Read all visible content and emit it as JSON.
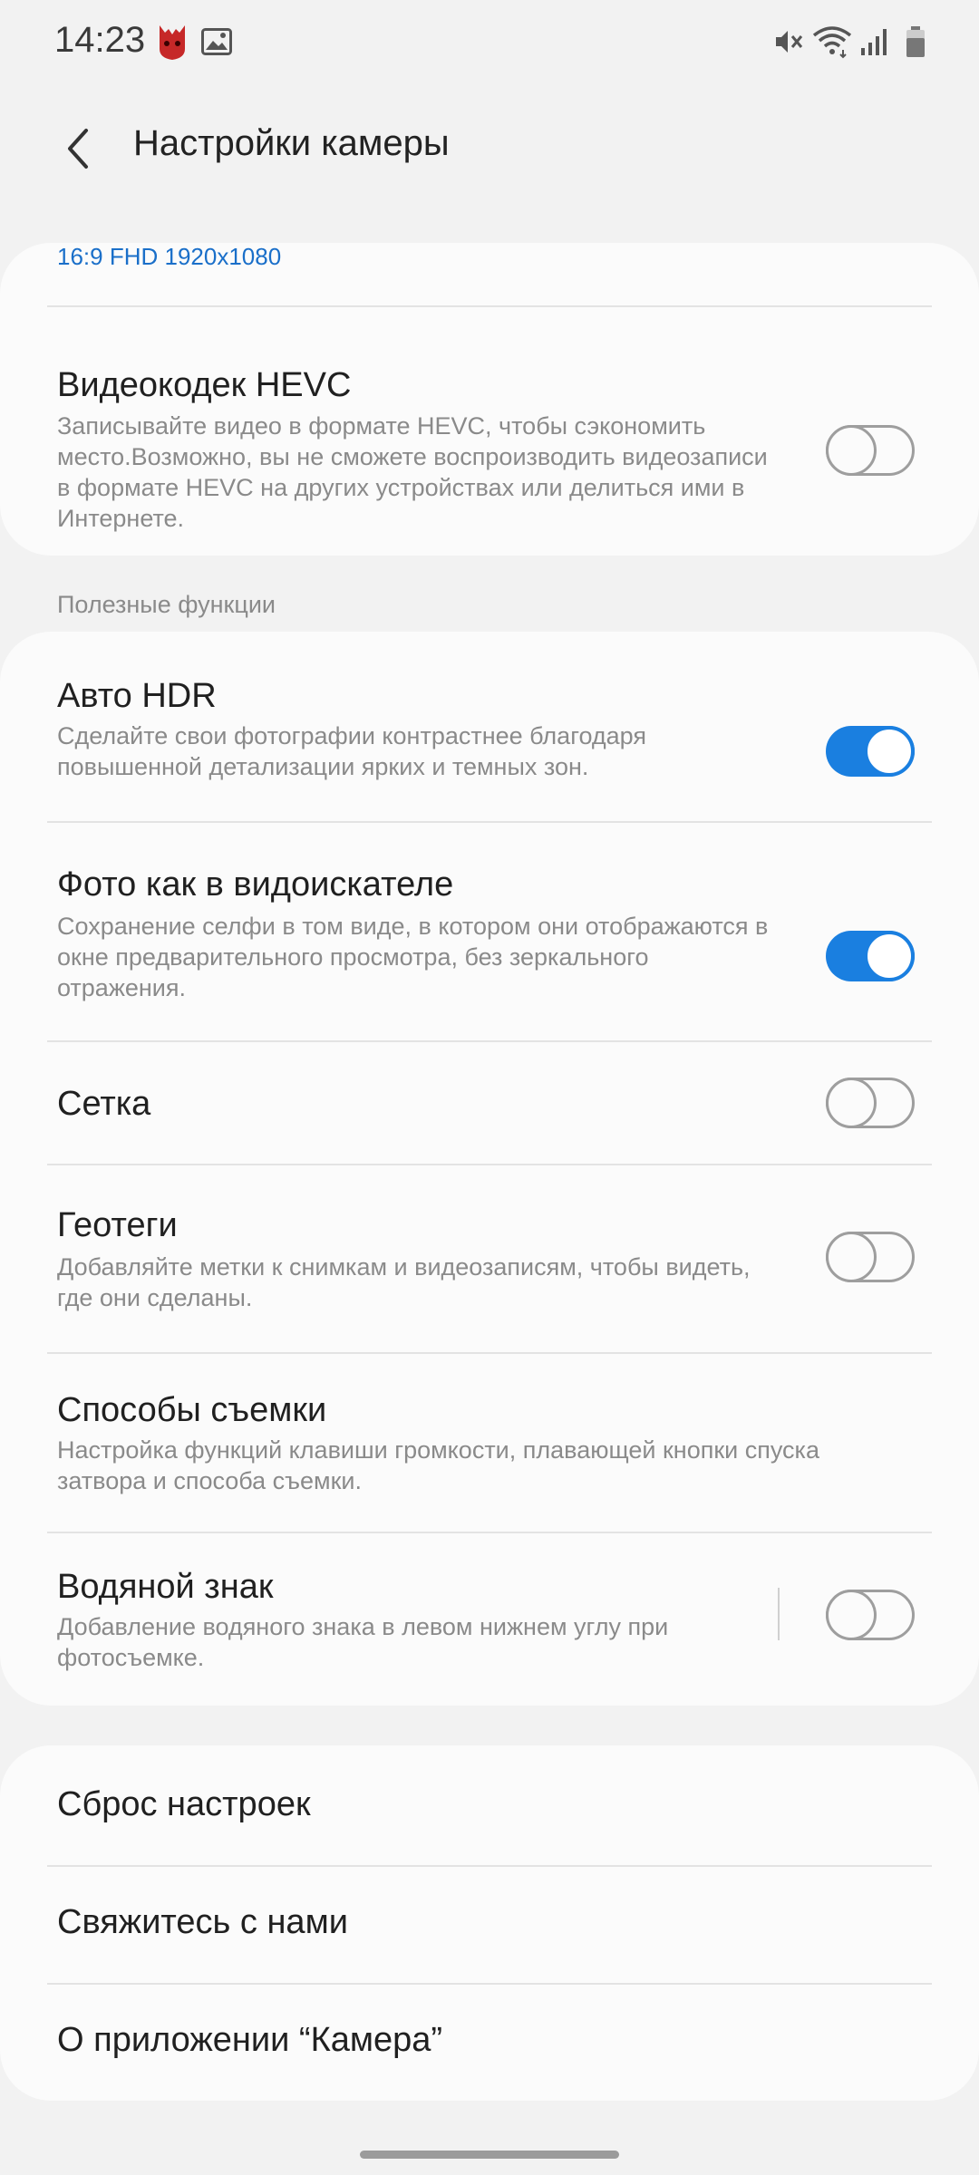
{
  "status_bar": {
    "time": "14:23"
  },
  "header": {
    "title": "Настройки камеры"
  },
  "top_card": {
    "resolution_value": "16:9 FHD 1920x1080",
    "hevc": {
      "title": "Видеокодек HEVC",
      "description": "Записывайте видео в формате HEVC, чтобы сэкономить место.Возможно, вы не сможете воспроизводить видеозаписи в формате HEVC на других устройствах или делиться ими в Интернете.",
      "enabled": false
    }
  },
  "useful_section": {
    "label": "Полезные функции",
    "items": [
      {
        "title": "Авто HDR",
        "description": "Сделайте свои фотографии контрастнее благодаря повышенной детализации ярких и темных зон.",
        "enabled": true
      },
      {
        "title": "Фото как в видоискателе",
        "description": "Сохранение селфи в том виде, в котором они отображаются в окне предварительного просмотра, без зеркального отражения.",
        "enabled": true
      },
      {
        "title": "Сетка",
        "description": "",
        "enabled": false
      },
      {
        "title": "Геотеги",
        "description": "Добавляйте метки к снимкам и видеозаписям, чтобы видеть, где они сделаны.",
        "enabled": false
      },
      {
        "title": "Способы съемки",
        "description": "Настройка функций клавиши громкости, плавающей кнопки спуска затвора и способа съемки."
      },
      {
        "title": "Водяной знак",
        "description": "Добавление водяного знака в левом нижнем углу при фотосъемке.",
        "enabled": false
      }
    ]
  },
  "bottom_card": {
    "items": [
      {
        "label": "Сброс настроек"
      },
      {
        "label": "Свяжитесь с нами"
      },
      {
        "label": "О приложении “Камера”"
      }
    ]
  },
  "colors": {
    "accent": "#1a7fe0",
    "background": "#f2f2f2",
    "card": "#fbfbfb"
  }
}
